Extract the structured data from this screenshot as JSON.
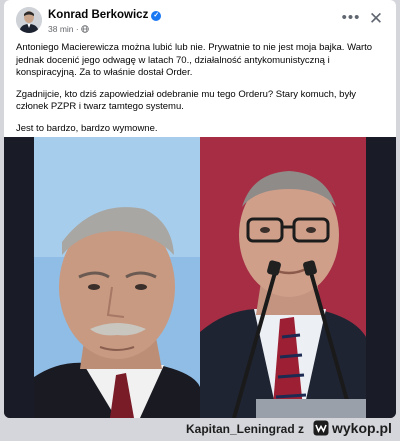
{
  "post": {
    "author": "Konrad Berkowicz",
    "time": "38 min",
    "meta_separator": "·",
    "paragraphs": [
      "Antoniego Macierewicza można lubić lub nie. Prywatnie to nie jest moja bajka. Warto jednak docenić jego odwagę w latach 70., działalność antykomunistyczną i konspiracyjną. Za to właśnie dostał Order.",
      "Zgadnijcie, kto dziś zapowiedział odebranie mu tego Orderu? Stary komuch, były członek PZPR i twarz tamtego systemu.",
      "Jest to bardzo, bardzo wymowne."
    ]
  },
  "icons": {
    "verified": "verified-badge-icon",
    "audience": "globe-icon",
    "more": "more-options-icon",
    "close": "close-icon"
  },
  "footer": {
    "username": "Kapitan_Leningrad",
    "suffix": "z",
    "site": "wykop.pl"
  },
  "colors": {
    "verified": "#1877f2",
    "text": "#050505",
    "meta": "#65676b",
    "page_background": "#d4d6db"
  }
}
